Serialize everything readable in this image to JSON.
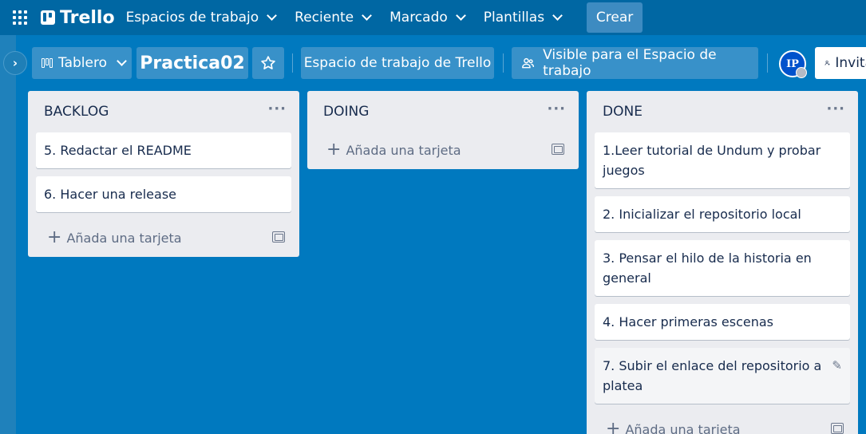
{
  "header": {
    "logo": "Trello",
    "nav": [
      {
        "label": "Espacios de trabajo"
      },
      {
        "label": "Reciente"
      },
      {
        "label": "Marcado"
      },
      {
        "label": "Plantillas"
      }
    ],
    "create_label": "Crear"
  },
  "board": {
    "view_label": "Tablero",
    "title": "Practica02",
    "workspace_label": "Espacio de trabajo de Trello",
    "visibility_label": "Visible para el Espacio de trabajo",
    "avatar_initials": "IP",
    "invite_label": "Invitar"
  },
  "lists": [
    {
      "title": "BACKLOG",
      "cards": [
        "5. Redactar el README",
        "6. Hacer una release"
      ],
      "add_label": "Añada una tarjeta"
    },
    {
      "title": "DOING",
      "cards": [],
      "add_label": "Añada una tarjeta"
    },
    {
      "title": "DONE",
      "cards": [
        "1.Leer tutorial de Undum y probar juegos",
        "2. Inicializar el repositorio local",
        "3. Pensar el hilo de la historia en general",
        "4. Hacer primeras escenas",
        "7. Subir el enlace del repositorio a platea"
      ],
      "add_label": "Añada una tarjeta"
    }
  ],
  "colors": {
    "board_bg": "#0079bf",
    "header_bg": "#0067a3",
    "list_bg": "#ebecf0",
    "avatar_bg": "#0052cc"
  }
}
